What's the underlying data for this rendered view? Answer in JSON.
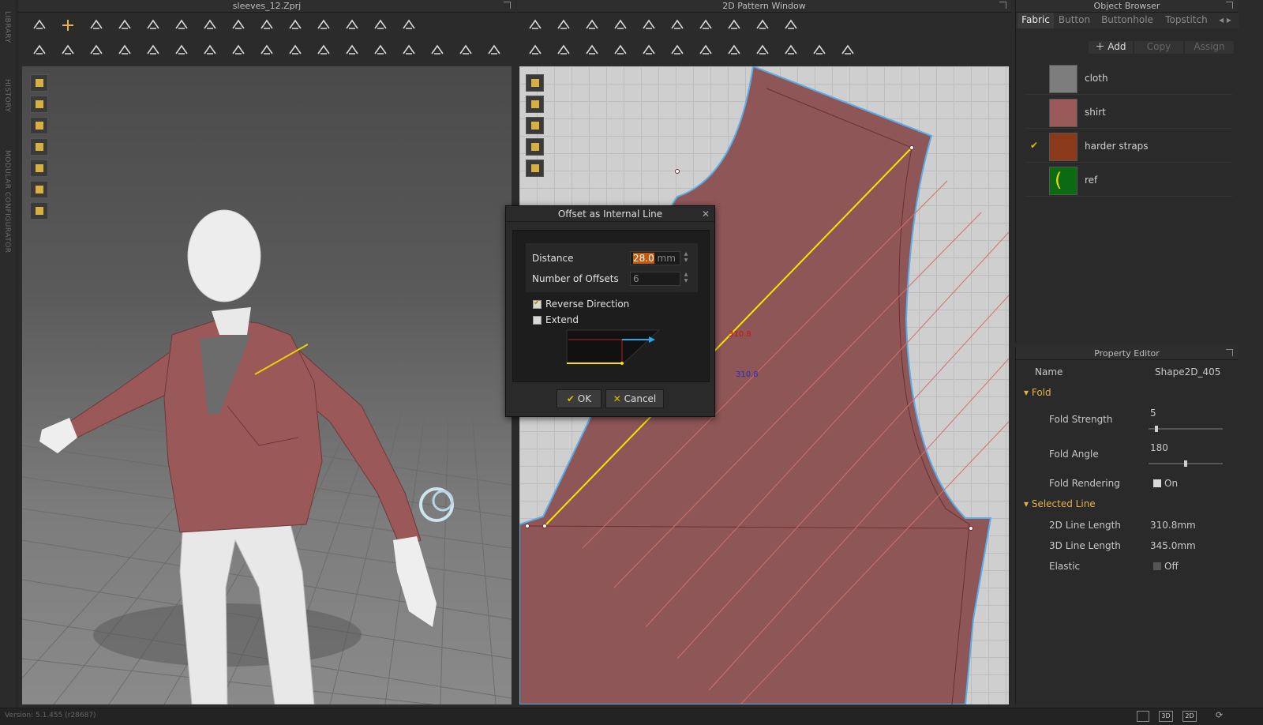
{
  "sidebar": {
    "library": "LIBRARY",
    "history": "HISTORY",
    "modular": "MODULAR CONFIGURATOR"
  },
  "viewport3d": {
    "title": "sleeves_12.Zprj"
  },
  "viewport2d": {
    "title": "2D Pattern Window",
    "measure_red": "310.8",
    "measure_blue": "310.8"
  },
  "dialog": {
    "title": "Offset as Internal Line",
    "distance_label": "Distance",
    "distance_value": "28.0",
    "distance_unit": "mm",
    "offsets_label": "Number of Offsets",
    "offsets_value": "6",
    "reverse_label": "Reverse Direction",
    "reverse_checked": true,
    "extend_label": "Extend",
    "extend_checked": false,
    "ok_label": "OK",
    "cancel_label": "Cancel"
  },
  "object_browser": {
    "title": "Object Browser",
    "tabs": [
      "Fabric",
      "Button",
      "Buttonhole",
      "Topstitch"
    ],
    "add_label": "Add",
    "copy_label": "Copy",
    "assign_label": "Assign",
    "fabrics": [
      {
        "name": "cloth",
        "color": "#7d7d7d",
        "selected": false
      },
      {
        "name": "shirt",
        "color": "#9a5a5a",
        "selected": false
      },
      {
        "name": "harder straps",
        "color": "#8a3a1a",
        "selected": true
      },
      {
        "name": "ref",
        "color": "#0c6b12",
        "selected": false
      }
    ]
  },
  "property_editor": {
    "title": "Property Editor",
    "name_label": "Name",
    "name_value": "Shape2D_405",
    "fold_section": "Fold",
    "fold_strength_label": "Fold Strength",
    "fold_strength_value": "5",
    "fold_strength_level": 0.09,
    "fold_angle_label": "Fold Angle",
    "fold_angle_value": "180",
    "fold_angle_level": 0.5,
    "fold_rendering_label": "Fold Rendering",
    "fold_rendering_value": "On",
    "selected_section": "Selected Line",
    "line2d_label": "2D Line Length",
    "line2d_value": "310.8mm",
    "line3d_label": "3D Line Length",
    "line3d_value": "345.0mm",
    "elastic_label": "Elastic",
    "elastic_value": "Off"
  },
  "statusbar": {
    "version": "Version: 5.1.455 (r28687)",
    "btn_3d": "3D",
    "btn_2d": "2D"
  },
  "colors": {
    "accent": "#e8b04a",
    "pattern": "#8e5656",
    "outline": "#5aaee8",
    "selected_line": "#f5e600"
  }
}
